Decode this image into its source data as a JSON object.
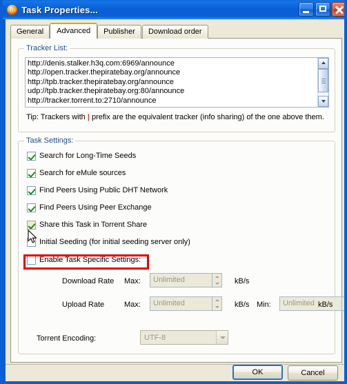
{
  "window": {
    "title": "Task Properties...",
    "icon": "globe-icon",
    "controls": {
      "minimize": "minimize-button",
      "maximize": "maximize-button",
      "close": "close-button"
    }
  },
  "tabs": [
    {
      "label": "General",
      "active": false
    },
    {
      "label": "Advanced",
      "active": true
    },
    {
      "label": "Publisher",
      "active": false
    },
    {
      "label": "Download order",
      "active": false
    }
  ],
  "tracker_group": {
    "legend": "Tracker List:",
    "trackers": [
      "http://denis.stalker.h3q.com:6969/announce",
      "http://open.tracker.thepiratebay.org/announce",
      "http://tpb.tracker.thepiratebay.org/announce",
      "udp://tpb.tracker.thepiratebay.org:80/announce",
      "http://tracker.torrent.to:2710/announce"
    ],
    "tip_before": "Tip: Trackers with ",
    "tip_pipe": "|",
    "tip_after": " prefix are the equivalent tracker (info sharing) of the one above them."
  },
  "settings_group": {
    "legend": "Task Settings:",
    "checkboxes": [
      {
        "label": "Search for Long-Time Seeds",
        "checked": true,
        "highlighted": false
      },
      {
        "label": "Search for eMule sources",
        "checked": true,
        "highlighted": false
      },
      {
        "label": "Find Peers Using Public DHT Network",
        "checked": true,
        "highlighted": false
      },
      {
        "label": "Find Peers Using Peer Exchange",
        "checked": true,
        "highlighted": false
      },
      {
        "label": "Share this Task in Torrent Share",
        "checked": true,
        "highlighted": true
      },
      {
        "label": "Initial Seeding (for initial seeding server only)",
        "checked": false,
        "highlighted": false
      },
      {
        "label": "Enable Task Specific Settings:",
        "checked": false,
        "highlighted": false
      }
    ],
    "download_rate": {
      "label": "Download Rate",
      "max_label": "Max:",
      "max_value": "Unlimited",
      "max_unit": "kB/s"
    },
    "upload_rate": {
      "label": "Upload Rate",
      "max_label": "Max:",
      "max_value": "Unlimited",
      "max_unit": "kB/s",
      "min_label": "Min:",
      "min_value": "Unlimited",
      "min_unit": "kB/s"
    },
    "encoding": {
      "label": "Torrent Encoding:",
      "value": "UTF-8"
    }
  },
  "footer": {
    "ok_label": "OK",
    "cancel_label": "Cancel"
  },
  "colors": {
    "titlebar": "#0a5fd4",
    "client": "#ece9d8",
    "tab_active_accent": "#f0a000",
    "group_legend": "#1d4f91",
    "highlight_rect": "#e60000",
    "checkmark": "#1a8a1a"
  }
}
